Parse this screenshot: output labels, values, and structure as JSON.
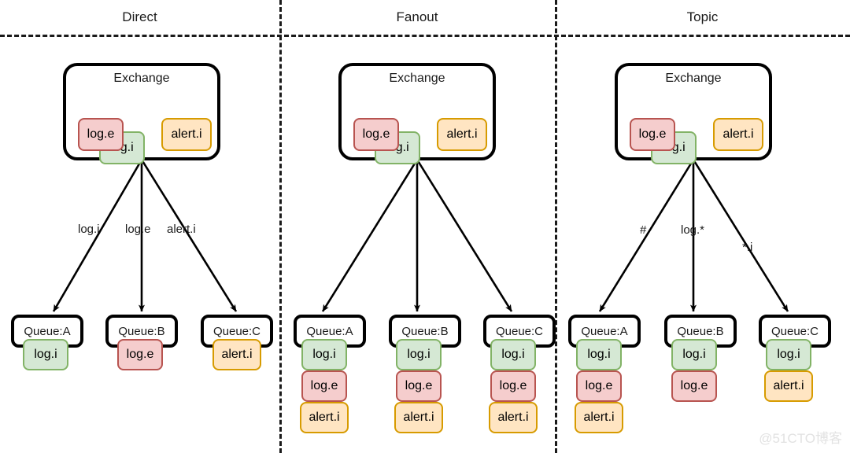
{
  "diagram": {
    "watermark": "@51CTO博客",
    "colors": {
      "green_fill": "#d5e8d4",
      "green_border": "#82b366",
      "red_fill": "#f5cdcd",
      "red_border": "#b85450",
      "orange_fill": "#ffe5c2",
      "orange_border": "#d79b00",
      "stroke": "#000000",
      "divider": "#1a1a1a"
    },
    "exchange_label": "Exchange",
    "sections": [
      {
        "title": "Direct",
        "exchange": {
          "label": "Exchange",
          "tags": [
            {
              "text": "log.i",
              "color": "green"
            },
            {
              "text": "log.e",
              "color": "red"
            },
            {
              "text": "alert.i",
              "color": "orange"
            }
          ]
        },
        "edges": [
          {
            "label": "log.i"
          },
          {
            "label": "log.e"
          },
          {
            "label": "alert.i"
          }
        ],
        "queues": [
          {
            "label": "Queue:A",
            "tags": [
              {
                "text": "log.i",
                "color": "green"
              }
            ]
          },
          {
            "label": "Queue:B",
            "tags": [
              {
                "text": "log.e",
                "color": "red"
              }
            ]
          },
          {
            "label": "Queue:C",
            "tags": [
              {
                "text": "alert.i",
                "color": "orange"
              }
            ]
          }
        ]
      },
      {
        "title": "Fanout",
        "exchange": {
          "label": "Exchange",
          "tags": [
            {
              "text": "log.i",
              "color": "green"
            },
            {
              "text": "log.e",
              "color": "red"
            },
            {
              "text": "alert.i",
              "color": "orange"
            }
          ]
        },
        "edges": [
          {
            "label": ""
          },
          {
            "label": ""
          },
          {
            "label": ""
          }
        ],
        "queues": [
          {
            "label": "Queue:A",
            "tags": [
              {
                "text": "log.i",
                "color": "green"
              },
              {
                "text": "log.e",
                "color": "red"
              },
              {
                "text": "alert.i",
                "color": "orange"
              }
            ]
          },
          {
            "label": "Queue:B",
            "tags": [
              {
                "text": "log.i",
                "color": "green"
              },
              {
                "text": "log.e",
                "color": "red"
              },
              {
                "text": "alert.i",
                "color": "orange"
              }
            ]
          },
          {
            "label": "Queue:C",
            "tags": [
              {
                "text": "log.i",
                "color": "green"
              },
              {
                "text": "log.e",
                "color": "red"
              },
              {
                "text": "alert.i",
                "color": "orange"
              }
            ]
          }
        ]
      },
      {
        "title": "Topic",
        "exchange": {
          "label": "Exchange",
          "tags": [
            {
              "text": "log.i",
              "color": "green"
            },
            {
              "text": "log.e",
              "color": "red"
            },
            {
              "text": "alert.i",
              "color": "orange"
            }
          ]
        },
        "edges": [
          {
            "label": "#"
          },
          {
            "label": "log.*"
          },
          {
            "label": "*.i"
          }
        ],
        "queues": [
          {
            "label": "Queue:A",
            "tags": [
              {
                "text": "log.i",
                "color": "green"
              },
              {
                "text": "log.e",
                "color": "red"
              },
              {
                "text": "alert.i",
                "color": "orange"
              }
            ]
          },
          {
            "label": "Queue:B",
            "tags": [
              {
                "text": "log.i",
                "color": "green"
              },
              {
                "text": "log.e",
                "color": "red"
              }
            ]
          },
          {
            "label": "Queue:C",
            "tags": [
              {
                "text": "log.i",
                "color": "green"
              },
              {
                "text": "alert.i",
                "color": "orange"
              }
            ]
          }
        ]
      }
    ]
  }
}
